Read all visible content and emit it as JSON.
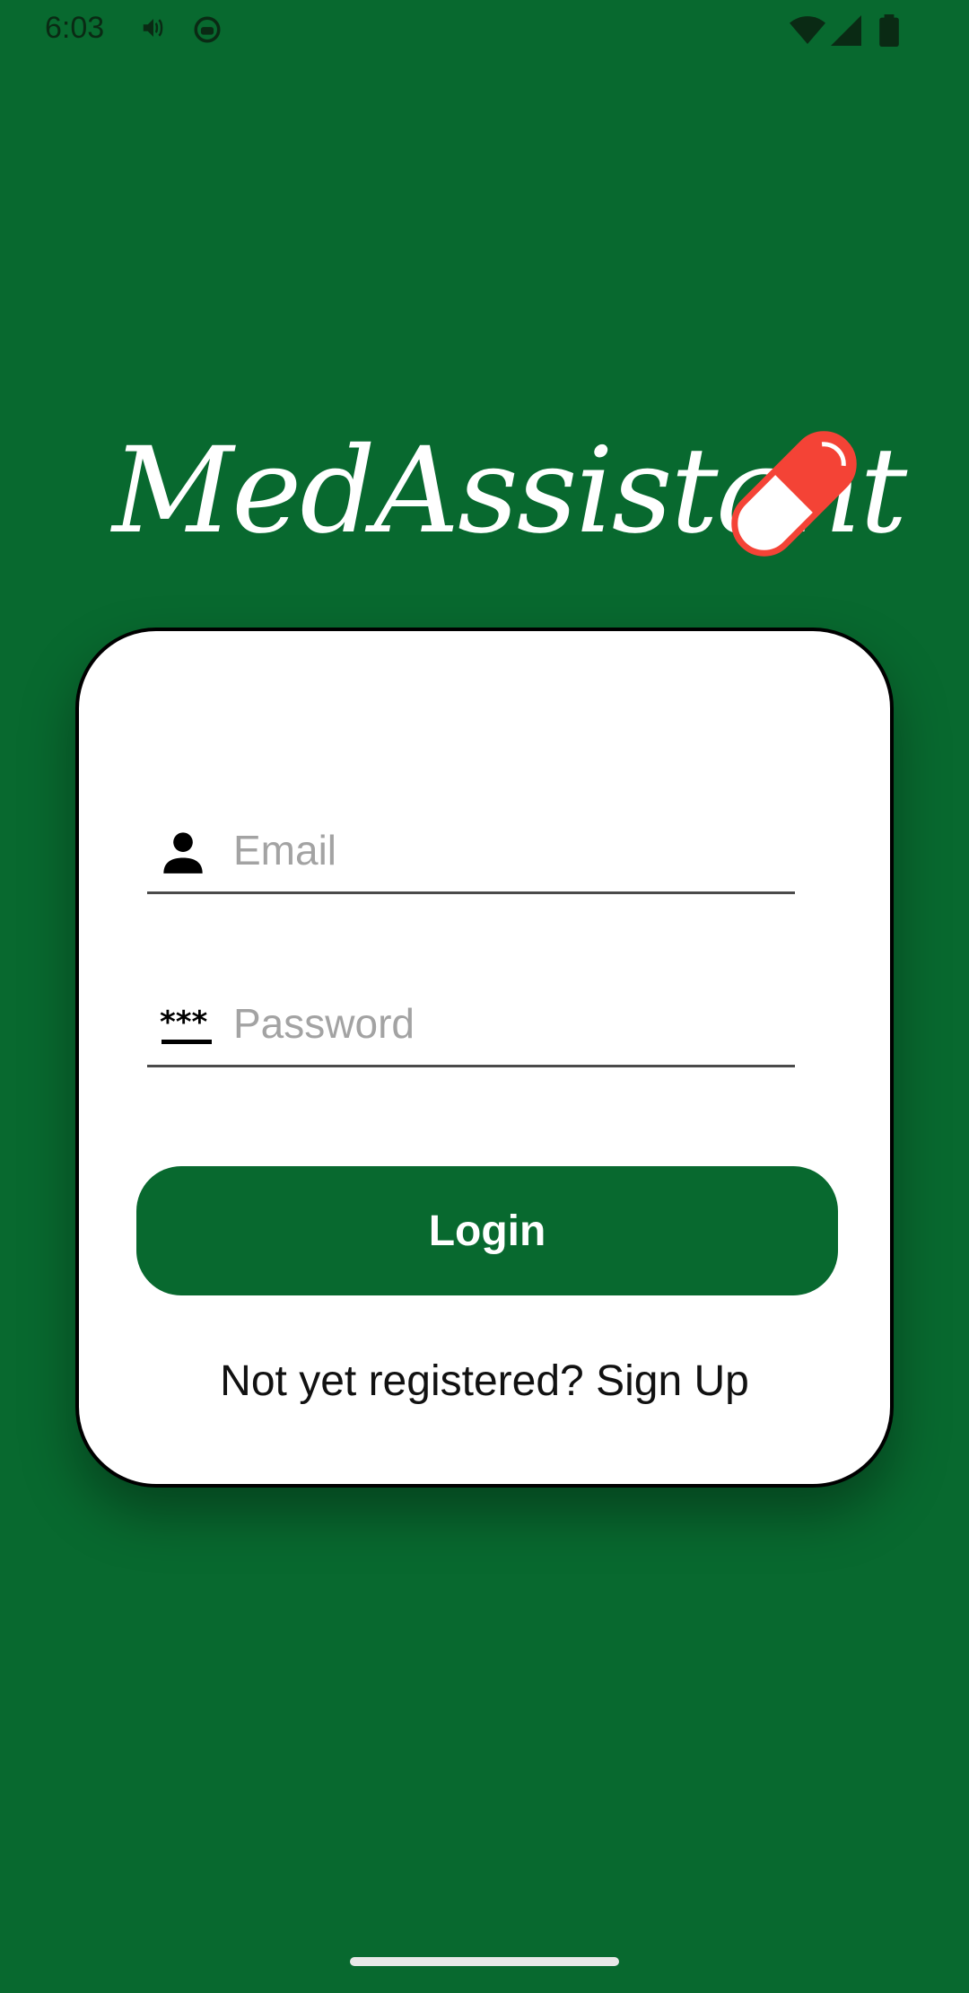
{
  "status_bar": {
    "time": "6:03",
    "icons": [
      "volume-icon",
      "robot-icon",
      "wifi-icon",
      "signal-icon",
      "battery-icon"
    ]
  },
  "app": {
    "title": "MedAssistant",
    "logo_icon": "pill-capsule-icon",
    "colors": {
      "background": "#08692F",
      "accent": "#F44336",
      "card": "#FFFFFF",
      "button": "#08692F"
    }
  },
  "login_form": {
    "email": {
      "icon": "person-icon",
      "placeholder": "Email",
      "value": ""
    },
    "password": {
      "icon": "password-dots-icon",
      "placeholder": "Password",
      "value": ""
    },
    "login_label": "Login",
    "signup_prompt": "Not yet registered?",
    "signup_link": "Sign Up"
  }
}
